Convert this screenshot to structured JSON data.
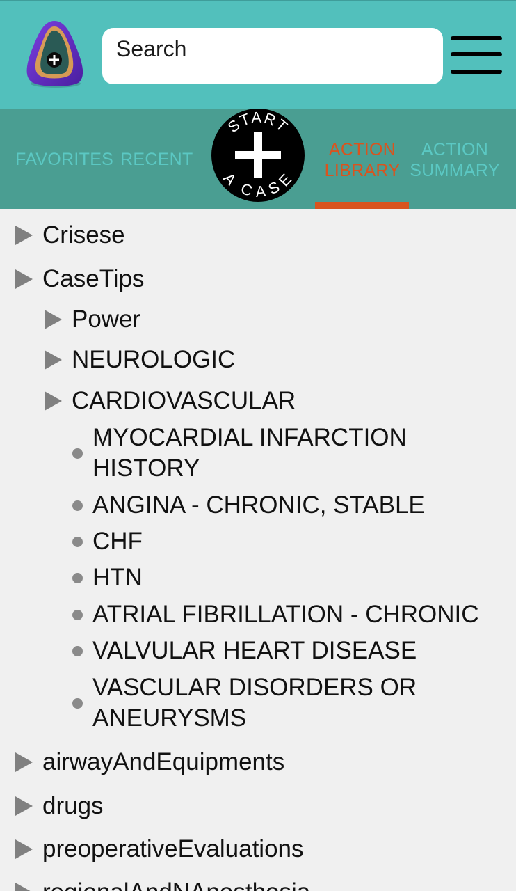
{
  "header": {
    "search": {
      "value": "Search"
    }
  },
  "tabs": {
    "favorites": "FAVORITES",
    "recent": "RECENT",
    "action_library": "ACTION LIBRARY",
    "action_summary": "ACTION SUMMARY",
    "active": "action_library",
    "start_case": {
      "top": "START",
      "bottom": "A CASE"
    }
  },
  "colors": {
    "header_bg": "#52c0bc",
    "tabbar_bg": "#4a9e92",
    "tab_text": "#5bc8c3",
    "active_tab": "#d9541e",
    "content_bg": "#f0f0f0"
  },
  "tree": {
    "crisese": "Crisese",
    "casetips": "CaseTips",
    "power": "Power",
    "neurologic": "NEUROLOGIC",
    "cardiovascular": "CARDIOVASCULAR",
    "cardio_items": [
      "MYOCARDIAL INFARCTION HISTORY",
      "ANGINA - CHRONIC, STABLE",
      "CHF",
      "HTN",
      "ATRIAL FIBRILLATION - CHRONIC",
      "VALVULAR HEART DISEASE",
      "VASCULAR DISORDERS OR ANEURYSMS"
    ],
    "airway": "airwayAndEquipments",
    "drugs": "drugs",
    "preop": "preoperativeEvaluations",
    "regional": "regionalAndNAnesthesia"
  }
}
